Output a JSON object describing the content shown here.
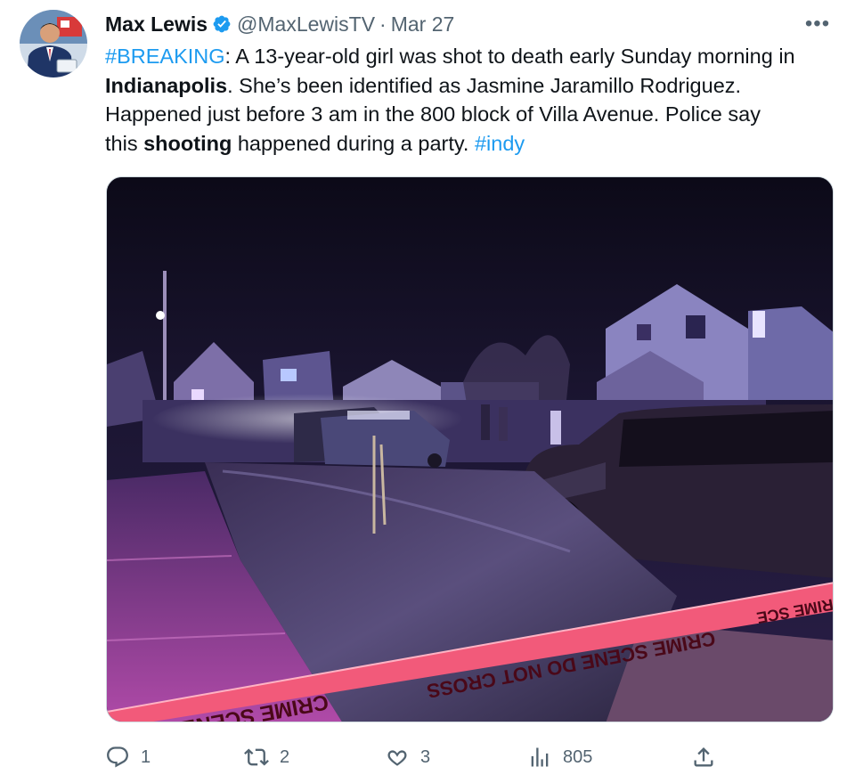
{
  "author": {
    "name": "Max Lewis",
    "handle": "@MaxLewisTV",
    "separator": "·",
    "date": "Mar 27",
    "more_label": "•••"
  },
  "tweet": {
    "hashtag_breaking": "#BREAKING",
    "l1_rest": ": A 13-year-old girl was shot to death early Sunday morning in",
    "l2_bold": "Indianapolis",
    "l2_rest": ". She’s been identified as Jasmine Jaramillo Rodriguez.",
    "l3": "Happened just before 3 am  in the 800 block of Villa Avenue. Police say",
    "l4_pre": "this ",
    "l4_bold": "shooting",
    "l4_mid": " happened during a party. ",
    "hashtag_indy": "#indy"
  },
  "media": {
    "tape_text_1": "CRIME SCENE",
    "tape_text_2": "CRIME SCENE DO NOT CROSS",
    "tape_text_3": "CRIME SCE"
  },
  "actions": {
    "replies": "1",
    "reposts": "2",
    "likes": "3",
    "views": "805"
  },
  "colors": {
    "link": "#1d9bf0",
    "secondary_text": "#536471",
    "verified": "#1d9bf0",
    "tape": "#f25a7a"
  }
}
